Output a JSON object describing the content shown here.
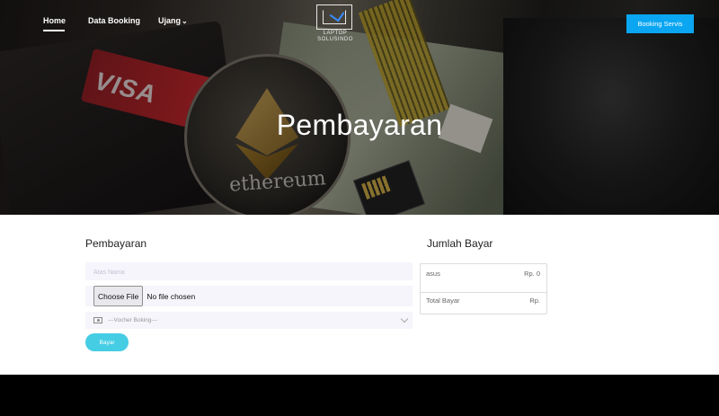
{
  "nav": {
    "home": "Home",
    "data_booking": "Data Booking",
    "user": "Ujang",
    "user_chevron": "⌄",
    "booking_servis": "Booking Servis"
  },
  "logo": {
    "line1": "LAPTOP",
    "line2": "SOLUSINDO"
  },
  "hero": {
    "title": "Pembayaran",
    "visa_text": "VISA",
    "coin_text": "ethereum"
  },
  "form": {
    "section_title": "Pembayaran",
    "name_placeholder": "Atas Nama",
    "choose_file_label": "Choose File",
    "file_status": "No file chosen",
    "voucher_selected": "---Vocher Boking---",
    "submit_label": "Bayar"
  },
  "summary": {
    "section_title": "Jumlah Bayar",
    "item_name": "asus",
    "item_price": "Rp. 0",
    "total_label": "Total Bayar",
    "total_price": "Rp."
  },
  "colors": {
    "booking_button": "#0aa6f2",
    "bayar_button": "#45cde4",
    "field_background": "#f5f5fb"
  }
}
